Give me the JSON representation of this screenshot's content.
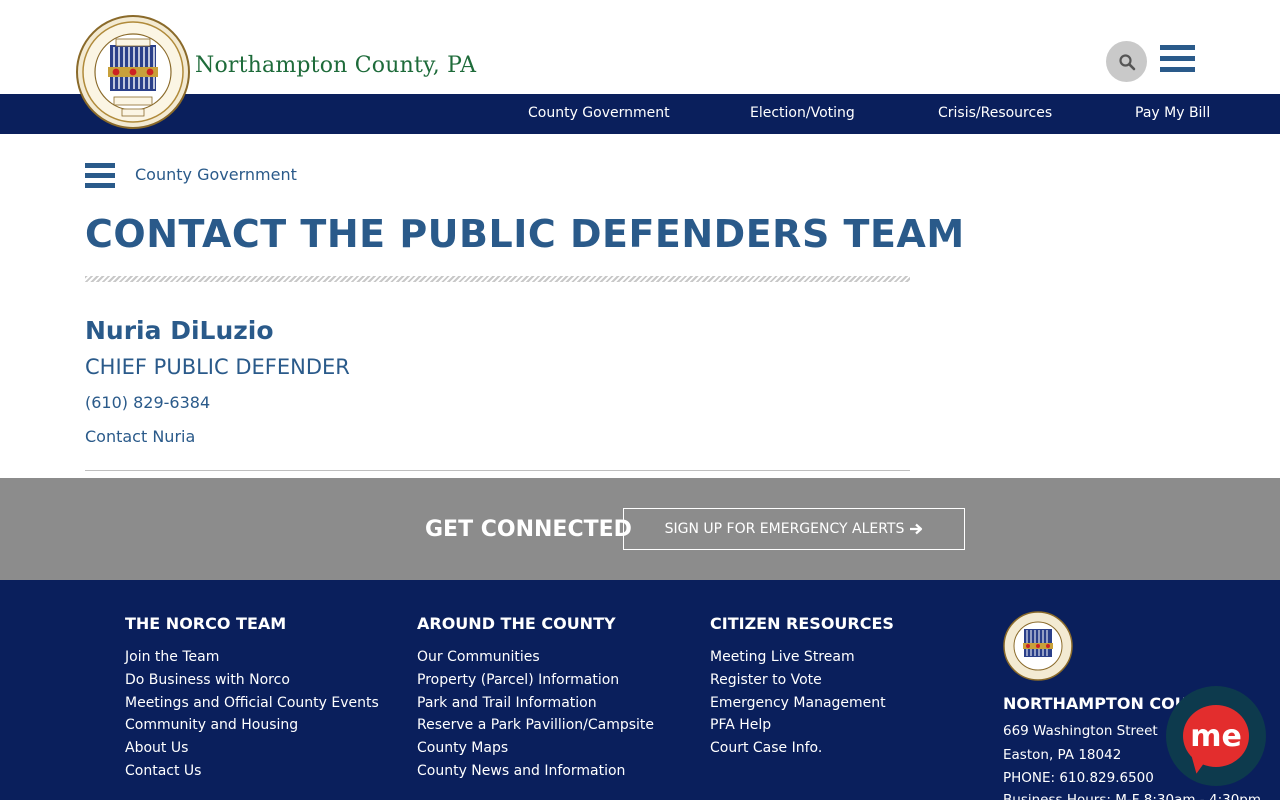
{
  "header": {
    "site_title": "Northampton County, PA",
    "seal_icon": "county-seal-icon",
    "search_icon": "search-icon",
    "menu_icon": "hamburger-menu-icon"
  },
  "nav": {
    "items": [
      {
        "label": "County Government"
      },
      {
        "label": "Election/Voting"
      },
      {
        "label": "Crisis/Resources"
      },
      {
        "label": "Pay My Bill"
      }
    ]
  },
  "breadcrumb": {
    "menu_icon": "hamburger-menu-icon",
    "label": "County Government"
  },
  "main": {
    "title": "CONTACT THE PUBLIC DEFENDERS TEAM",
    "person": {
      "name": "Nuria DiLuzio",
      "role": "CHIEF PUBLIC DEFENDER",
      "phone": "(610) 829-6384",
      "contact_label": "Contact Nuria"
    }
  },
  "connected": {
    "title": "GET CONNECTED",
    "button_label": "SIGN UP FOR EMERGENCY ALERTS",
    "button_icon": "arrow-right-icon"
  },
  "footer": {
    "columns": [
      {
        "title": "THE NORCO TEAM",
        "links": [
          "Join the Team",
          "Do Business with Norco",
          "Meetings and Official County Events",
          "Community and Housing",
          "About Us",
          "Contact Us"
        ]
      },
      {
        "title": "AROUND THE COUNTY",
        "links": [
          "Our Communities",
          "Property (Parcel) Information",
          "Park and Trail Information",
          "Reserve a Park Pavillion/Campsite",
          "County Maps",
          "County News and Information"
        ]
      },
      {
        "title": "CITIZEN RESOURCES",
        "links": [
          "Meeting Live Stream",
          "Register to Vote",
          "Emergency Management",
          "PFA Help",
          "Court Case Info."
        ]
      }
    ],
    "org": {
      "name": "NORTHAMPTON COUNTY",
      "street": "669 Washington Street",
      "city": "Easton, PA 18042",
      "phone": "PHONE: 610.829.6500",
      "hours": "Business Hours: M-F 8:30am - 4:30pm"
    }
  },
  "chat_badge": {
    "label": "me"
  },
  "colors": {
    "navy": "#0a1f5c",
    "heading_blue": "#2a5a8a",
    "title_green": "#1e6b3a",
    "gray_band": "#8c8c8c",
    "badge_red": "#e32d2d"
  }
}
